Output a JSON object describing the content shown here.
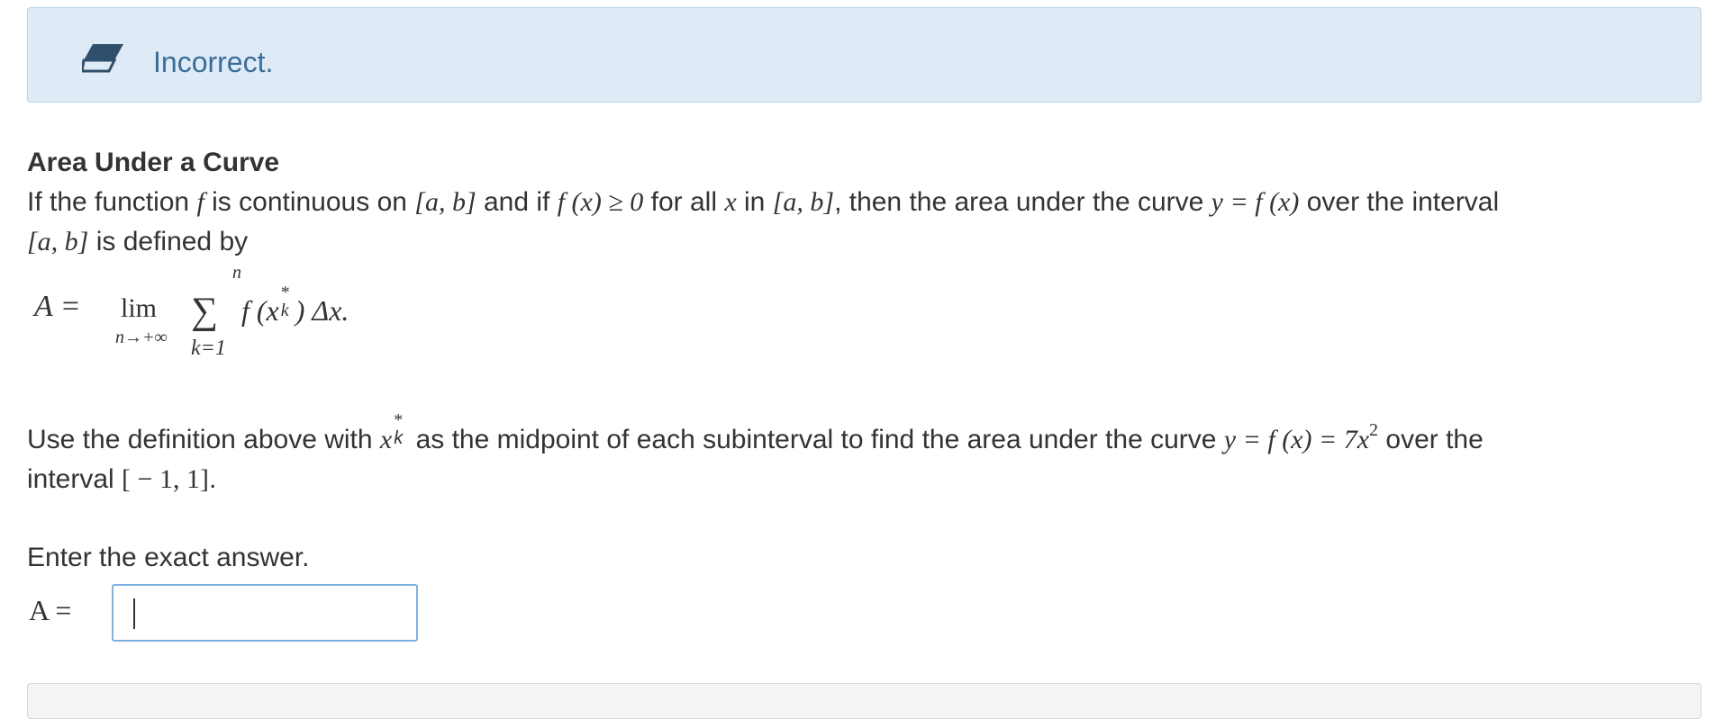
{
  "feedback": {
    "label": "Incorrect.",
    "icon": "eraser-icon"
  },
  "definition": {
    "title": "Area Under a Curve",
    "line1": {
      "t1": "If the function ",
      "m1": "f",
      "t2": " is continuous on ",
      "m2": "[a, b]",
      "t3": " and if ",
      "m3": "f (x) ≥ 0",
      "t4": " for all ",
      "m4": "x",
      "t5": " in ",
      "m5": "[a, b]",
      "t6": ", then the area under the curve ",
      "m6": "y = f (x)",
      "t7": " over the interval"
    },
    "line2": {
      "m1": "[a, b]",
      "t1": " is defined by"
    }
  },
  "formula": {
    "lhs": "A =",
    "lim": "lim",
    "lim_sub": "n→+∞",
    "sum": "∑",
    "sum_top": "n",
    "sum_bottom": "k=1",
    "body": "f (x",
    "star": "*",
    "k": "k",
    "tail": ") Δx."
  },
  "problem": {
    "t1": "Use the definition above with ",
    "x": "x",
    "star": "*",
    "k": "k",
    "t2": " as the midpoint of each subinterval to find the area under the curve ",
    "m1": "y = f (x) = 7x",
    "exp": "2",
    "t3": " over the",
    "t4": "interval ",
    "m2": "[ − 1, 1]",
    "t5": "."
  },
  "instruction": "Enter the exact answer.",
  "answer": {
    "label": "A =",
    "value": ""
  }
}
